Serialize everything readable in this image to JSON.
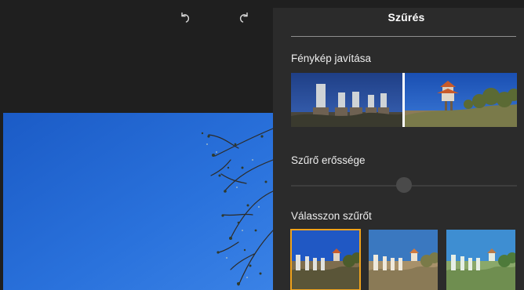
{
  "toolbar": {
    "undo_icon": "undo-icon",
    "redo_icon": "redo-icon"
  },
  "panel": {
    "title": "Szűrés",
    "enhance_label": "Fénykép javítása",
    "strength_label": "Szűrő erőssége",
    "choose_label": "Válasszon szűrőt",
    "filter_strength": 0.5,
    "filters": [
      {
        "name": "original",
        "selected": true
      },
      {
        "name": "warm",
        "selected": false
      },
      {
        "name": "green",
        "selected": false
      }
    ]
  },
  "colors": {
    "app_background": "#1f1f1f",
    "panel_background": "#2b2b2b",
    "selection_accent": "#f0a21c",
    "text": "#ededed"
  }
}
